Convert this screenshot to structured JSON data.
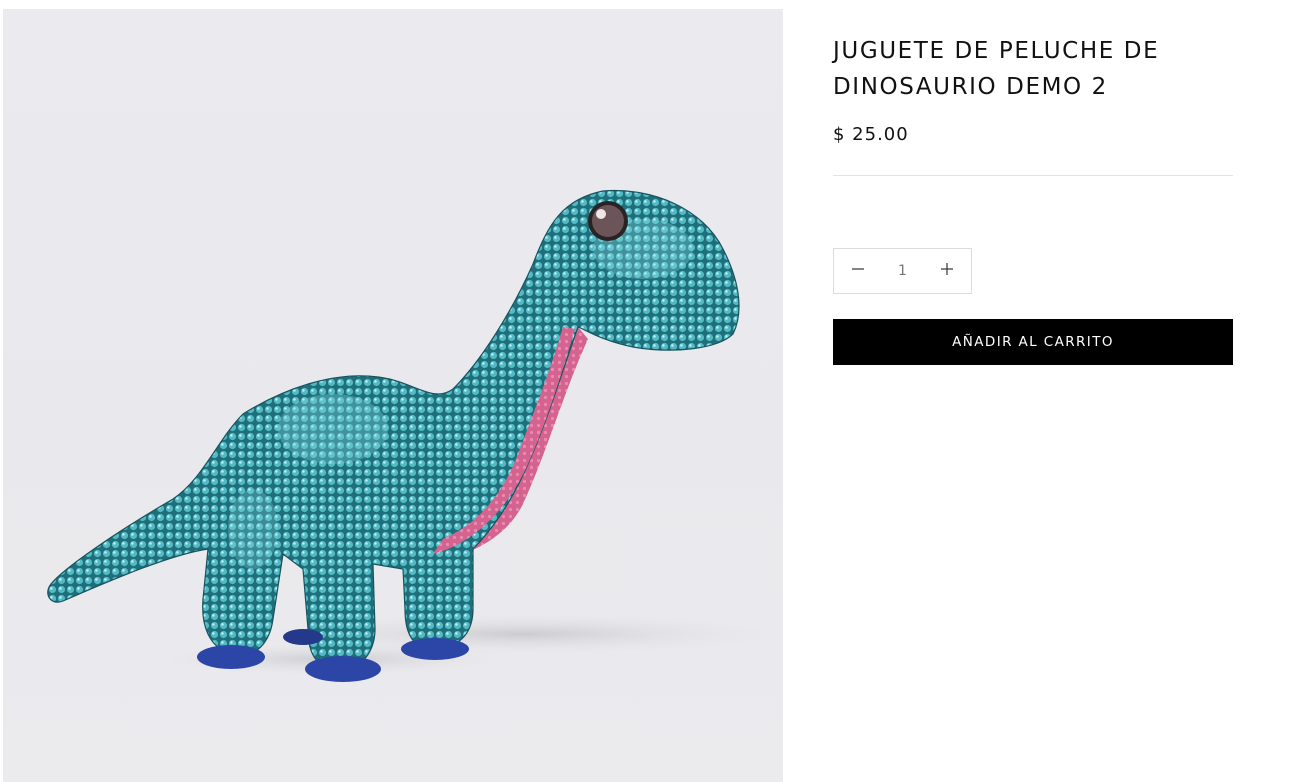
{
  "product": {
    "title": "JUGUETE DE PELUCHE DE DINOSAURIO DEMO 2",
    "price": "$ 25.00",
    "image": {
      "subject": "sequined plush dinosaur toy",
      "colors": {
        "background": "#eaeaee",
        "sequins": "#3fa7b3",
        "belly": "#d86a98",
        "feet": "#2c46a8"
      }
    }
  },
  "quantity": {
    "value": "1",
    "decrease_icon": "minus-icon",
    "increase_icon": "plus-icon"
  },
  "actions": {
    "add_to_cart_label": "AÑADIR AL CARRITO"
  },
  "colors": {
    "button_bg": "#000000",
    "button_text": "#ffffff",
    "text": "#111111",
    "divider": "#e3e3e3"
  }
}
